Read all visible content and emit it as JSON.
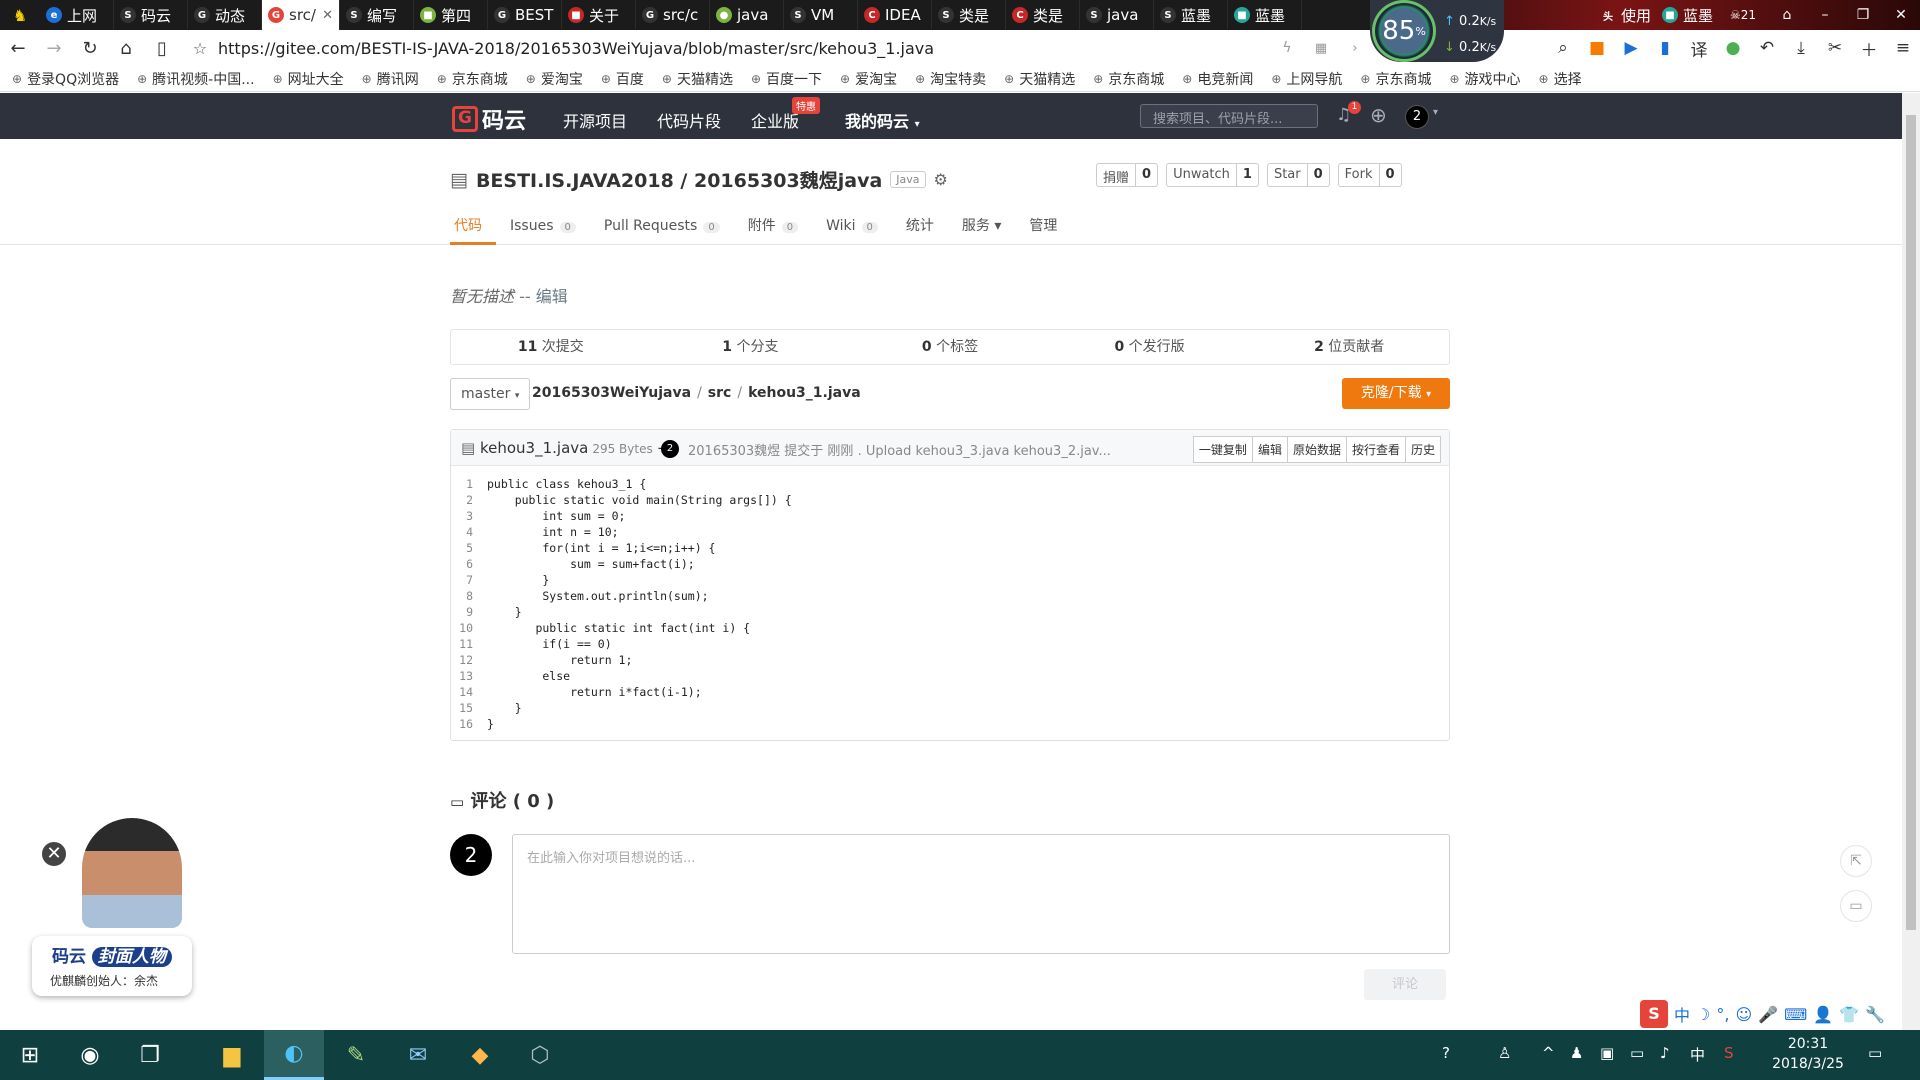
{
  "browser": {
    "tabs": [
      {
        "label": "上网",
        "color": "#1b6fd6",
        "glyph": "e",
        "active": false
      },
      {
        "label": "码云",
        "color": "#333333",
        "glyph": "S",
        "active": false
      },
      {
        "label": "动态",
        "color": "#333333",
        "glyph": "G",
        "active": false
      },
      {
        "label": "src/",
        "color": "#e6443a",
        "glyph": "G",
        "active": true
      },
      {
        "label": "编写",
        "color": "#333333",
        "glyph": "S",
        "active": false
      },
      {
        "label": "第四",
        "color": "#7cb342",
        "glyph": "■",
        "active": false
      },
      {
        "label": "BEST",
        "color": "#333333",
        "glyph": "G",
        "active": false
      },
      {
        "label": "关于",
        "color": "#c62828",
        "glyph": "■",
        "active": false
      },
      {
        "label": "src/c",
        "color": "#333333",
        "glyph": "G",
        "active": false
      },
      {
        "label": "java",
        "color": "#7cb342",
        "glyph": "●",
        "active": false
      },
      {
        "label": "VM",
        "color": "#333333",
        "glyph": "S",
        "active": false
      },
      {
        "label": "IDEA",
        "color": "#c62828",
        "glyph": "C",
        "active": false
      },
      {
        "label": "类是",
        "color": "#333333",
        "glyph": "S",
        "active": false
      },
      {
        "label": "类是",
        "color": "#c62828",
        "glyph": "C",
        "active": false
      },
      {
        "label": "java",
        "color": "#333333",
        "glyph": "S",
        "active": false
      },
      {
        "label": "蓝墨",
        "color": "#333333",
        "glyph": "S",
        "active": false
      },
      {
        "label": "蓝墨",
        "color": "#26a69a",
        "glyph": "■",
        "active": false
      }
    ],
    "tab_right": [
      {
        "label": "使用",
        "glyph": "头"
      },
      {
        "label": "蓝墨",
        "glyph": "■"
      }
    ],
    "tab_count": "21",
    "speed": {
      "percent": "85",
      "up": "0.2",
      "down": "0.2",
      "unit": "K/s"
    },
    "url": "https://gitee.com/BESTI-IS-JAVA-2018/20165303WeiYujava/blob/master/src/kehou3_1.java",
    "bookmarks": [
      "登录QQ浏览器",
      "腾讯视频-中国...",
      "网址大全",
      "腾讯网",
      "京东商城",
      "爱淘宝",
      "百度",
      "天猫精选",
      "百度一下",
      "爱淘宝",
      "淘宝特卖",
      "天猫精选",
      "京东商城",
      "电竞新闻",
      "上网导航",
      "京东商城",
      "游戏中心",
      "选择"
    ]
  },
  "header": {
    "logo": "码云",
    "nav": [
      "开源项目",
      "代码片段",
      "企业版",
      "我的码云"
    ],
    "badge": "特惠",
    "search_placeholder": "搜索项目、代码片段...",
    "notify_count": "1",
    "avatar": "2"
  },
  "project": {
    "title": "BESTI.IS.JAVA2018 / 20165303魏煜java",
    "lang": "Java",
    "actions": [
      {
        "label": "捐赠",
        "count": "0"
      },
      {
        "label": "Unwatch",
        "count": "1"
      },
      {
        "label": "Star",
        "count": "0"
      },
      {
        "label": "Fork",
        "count": "0"
      }
    ],
    "tabs": [
      {
        "label": "代码",
        "count": null
      },
      {
        "label": "Issues",
        "count": "0"
      },
      {
        "label": "Pull Requests",
        "count": "0"
      },
      {
        "label": "附件",
        "count": "0"
      },
      {
        "label": "Wiki",
        "count": "0"
      },
      {
        "label": "统计",
        "count": null
      },
      {
        "label": "服务 ▾",
        "count": null
      },
      {
        "label": "管理",
        "count": null
      }
    ],
    "desc": "暂无描述",
    "desc_edit": "-- 编辑",
    "stats": [
      {
        "num": "11",
        "label": "次提交"
      },
      {
        "num": "1",
        "label": "个分支"
      },
      {
        "num": "0",
        "label": "个标签"
      },
      {
        "num": "0",
        "label": "个发行版"
      },
      {
        "num": "2",
        "label": "位贡献者"
      }
    ]
  },
  "path": {
    "branch": "master",
    "crumbs": [
      "20165303WeiYujava",
      "src",
      "kehou3_1.java"
    ],
    "clone": "克隆/下载"
  },
  "file": {
    "name": "kehou3_1.java",
    "size": "295 Bytes",
    "commit_avatar": "2",
    "commit_msg": "20165303魏煜 提交于 刚刚 . Upload kehou3_3.java kehou3_2.jav...",
    "tools": [
      "一键复制",
      "编辑",
      "原始数据",
      "按行查看",
      "历史"
    ],
    "lines": [
      "public class kehou3_1 {",
      "    public static void main(String args[]) {",
      "        int sum = 0;",
      "        int n = 10;",
      "        for(int i = 1;i<=n;i++) {",
      "            sum = sum+fact(i);",
      "        }",
      "        System.out.println(sum);",
      "    }",
      "       public static int fact(int i) {",
      "        if(i == 0)",
      "            return 1;",
      "        else",
      "            return i*fact(i-1);",
      "    }",
      "}"
    ]
  },
  "comments": {
    "title": "评论 ( 0 )",
    "avatar": "2",
    "placeholder": "在此输入你对项目想说的话...",
    "submit": "评论"
  },
  "promo": {
    "brand": "码云",
    "badge": "封面人物",
    "sub": "优麒麟创始人：余杰"
  },
  "ime": {
    "logo": "S",
    "items": [
      "中",
      "☽",
      "°,",
      "☺",
      "🎤",
      "⌨",
      "👤",
      "👕",
      "🔧"
    ]
  },
  "taskbar": {
    "clock_time": "20:31",
    "clock_date": "2018/3/25",
    "tray_ime": "中"
  }
}
